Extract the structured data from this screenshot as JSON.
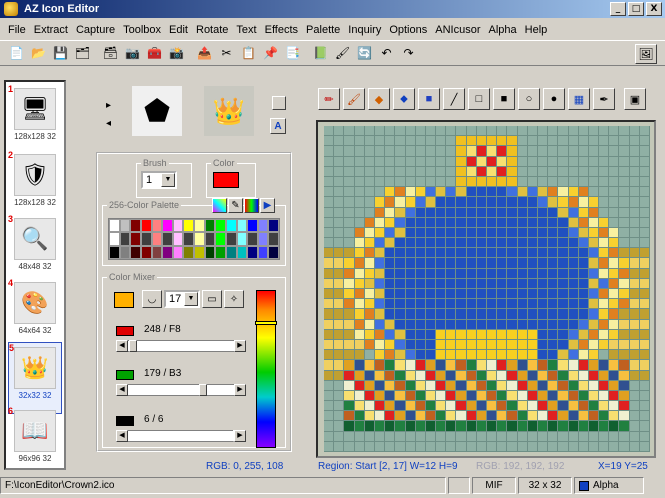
{
  "window": {
    "title": "AZ Icon Editor",
    "minimize": "_",
    "maximize": "□",
    "close": "X"
  },
  "menu": [
    "File",
    "Extract",
    "Capture",
    "Toolbox",
    "Edit",
    "Rotate",
    "Text",
    "Effects",
    "Palette",
    "Inquiry",
    "Options",
    "ANIcusor",
    "Alpha",
    "Help"
  ],
  "icon_list": [
    {
      "num": "1",
      "label": "128x128 32",
      "icon": "monitor-icon",
      "glyph": "🖥"
    },
    {
      "num": "2",
      "label": "128x128 32",
      "icon": "shield-icon",
      "glyph": "🛡"
    },
    {
      "num": "3",
      "label": "48x48 32",
      "icon": "magnifier-icon",
      "glyph": "🔍"
    },
    {
      "num": "4",
      "label": "64x64 32",
      "icon": "paint-palette-icon",
      "glyph": "🎨"
    },
    {
      "num": "5",
      "label": "32x32 32",
      "icon": "crown-icon",
      "glyph": "👑",
      "selected": true
    },
    {
      "num": "6",
      "label": "96x96 32",
      "icon": "book-icon",
      "glyph": "📖"
    }
  ],
  "brush": {
    "legend": "Brush",
    "value": "1",
    "color_legend": "Color"
  },
  "palette": {
    "legend": "256-Color Palette"
  },
  "mixer": {
    "legend": "Color Mixer",
    "size": "17",
    "red_text": "248 / F8",
    "green_text": "179 / B3",
    "blue_text": "6 / 6"
  },
  "status": {
    "rgb": "RGB: 0, 255, 108",
    "region": "Region: Start [2, 17]  W=12 H=9",
    "rgb2": "RGB: 192, 192, 192",
    "xy": "X=19  Y=25",
    "path": "F:\\IconEditor\\Crown2.ico",
    "format": "MIF",
    "size": "32 x 32",
    "alpha": "Alpha"
  },
  "colors": {
    "brush_color": "#ff0000",
    "mixer_color": "#ffb000"
  }
}
